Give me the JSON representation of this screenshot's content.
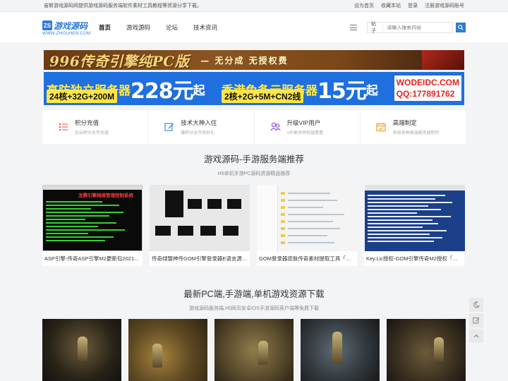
{
  "topbar": {
    "notice": "宙斯游戏源码网提供游戏源码服务端软件素材工具教程等资源分享下载。",
    "links": [
      "设为首页",
      "收藏本站",
      "登录",
      "注册游戏源码账号"
    ]
  },
  "header": {
    "logo_text": "游戏源码",
    "logo_mark": "ZS",
    "logo_sub": "WWW.ZHOUHEN.COM",
    "nav": [
      "首页",
      "游戏源码",
      "论坛",
      "技术资讯"
    ],
    "search_scope": "帖子",
    "search_placeholder": "请输入搜索内容"
  },
  "banner1": {
    "main": "996传奇引擎纯PC版",
    "sub": "— 无分成 无授权费"
  },
  "banner2": {
    "left_title": "高防独立服务器",
    "left_price": "228元",
    "left_qi": "起",
    "left_spec": "24核+32G+200M",
    "right_title": "香港免备云服务器",
    "right_price": "15元",
    "right_qi": "起",
    "right_spec": "2核+2G+5M+CN2线",
    "site": "WODEIDC.COM",
    "qq": "QQ:177891762"
  },
  "features": [
    {
      "title": "积分充值",
      "desc": "论坛积分全币充值",
      "icon": "list-icon",
      "color": "#e8483c"
    },
    {
      "title": "技术大神入住",
      "desc": "赚积分全币获好礼",
      "icon": "edit-icon",
      "color": "#3d8be0"
    },
    {
      "title": "升级VIP用户",
      "desc": "VIP更多特权级看看",
      "icon": "users-icon",
      "color": "#8a4fd6"
    },
    {
      "title": "高端制定",
      "desc": "来接各种高端服务器制作",
      "icon": "calendar-check-icon",
      "color": "#f0a020"
    }
  ],
  "section1": {
    "title": "游戏源码-手游服务端推荐",
    "subtitle": "H5单机手游PC源码资源精品推荐",
    "cards": [
      {
        "title": "ASP引擎-传奇ASP引擎M2更新包2021110…",
        "thumb_text": "龙腾引擎网络管理控制系统"
      },
      {
        "title": "传奇绿盟神传GOM引擎登录器E语言源码…"
      },
      {
        "title": "GOM登录器皮肤传奇素材提取工具「一键…"
      },
      {
        "title": "Key.Lic授权-GOM引擎传奇M2授权「无限…"
      }
    ]
  },
  "section2": {
    "title": "最新PC端,手游端,单机游戏资源下载",
    "subtitle": "游戏源码服务端,H5网页安卓IOS手游源码客户端等免费下载"
  },
  "colors": {
    "accent": "#2e7cd6",
    "banner_blue": "#1f6fde",
    "banner_yellow": "#ffe646"
  }
}
